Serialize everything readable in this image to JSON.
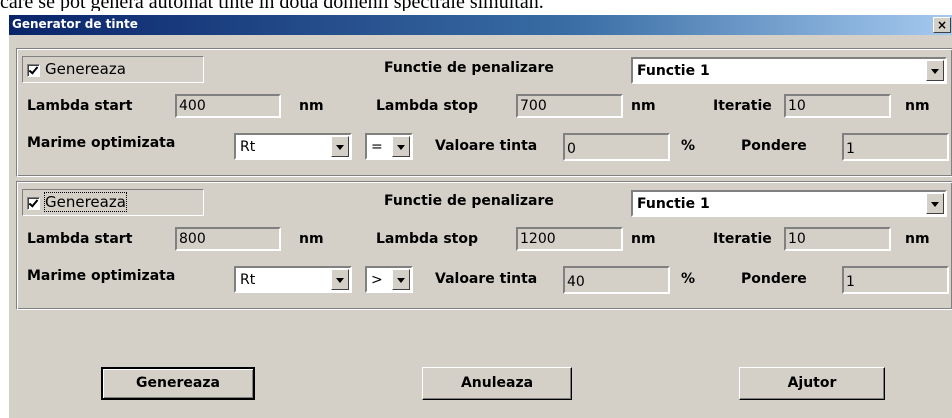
{
  "top_text": "care se pot genera automat tinte in doua domenii spectrale simultan.",
  "window": {
    "title": "Generator de tinte",
    "close": "×"
  },
  "groups": [
    {
      "generate_label": "Genereaza",
      "generate_checked": true,
      "penalty_label": "Functie de penalizare",
      "penalty_value": "Functie 1",
      "lambda_start_label": "Lambda start",
      "lambda_start": "400",
      "unit1": "nm",
      "lambda_stop_label": "Lambda stop",
      "lambda_stop": "700",
      "unit2": "nm",
      "iteration_label": "Iteratie",
      "iteration": "10",
      "unit3": "nm",
      "optimized_label": "Marime optimizata",
      "optimized_value": "Rt",
      "operator": "=",
      "target_label": "Valoare tinta",
      "target_value": "0",
      "percent": "%",
      "weight_label": "Pondere",
      "weight_value": "1"
    },
    {
      "generate_label": "Genereaza",
      "generate_checked": true,
      "penalty_label": "Functie de penalizare",
      "penalty_value": "Functie 1",
      "lambda_start_label": "Lambda start",
      "lambda_start": "800",
      "unit1": "nm",
      "lambda_stop_label": "Lambda stop",
      "lambda_stop": "1200",
      "unit2": "nm",
      "iteration_label": "Iteratie",
      "iteration": "10",
      "unit3": "nm",
      "optimized_label": "Marime optimizata",
      "optimized_value": "Rt",
      "operator": ">",
      "target_label": "Valoare tinta",
      "target_value": "40",
      "percent": "%",
      "weight_label": "Pondere",
      "weight_value": "1"
    }
  ],
  "buttons": {
    "generate": "Genereaza",
    "cancel": "Anuleaza",
    "help": "Ajutor"
  }
}
